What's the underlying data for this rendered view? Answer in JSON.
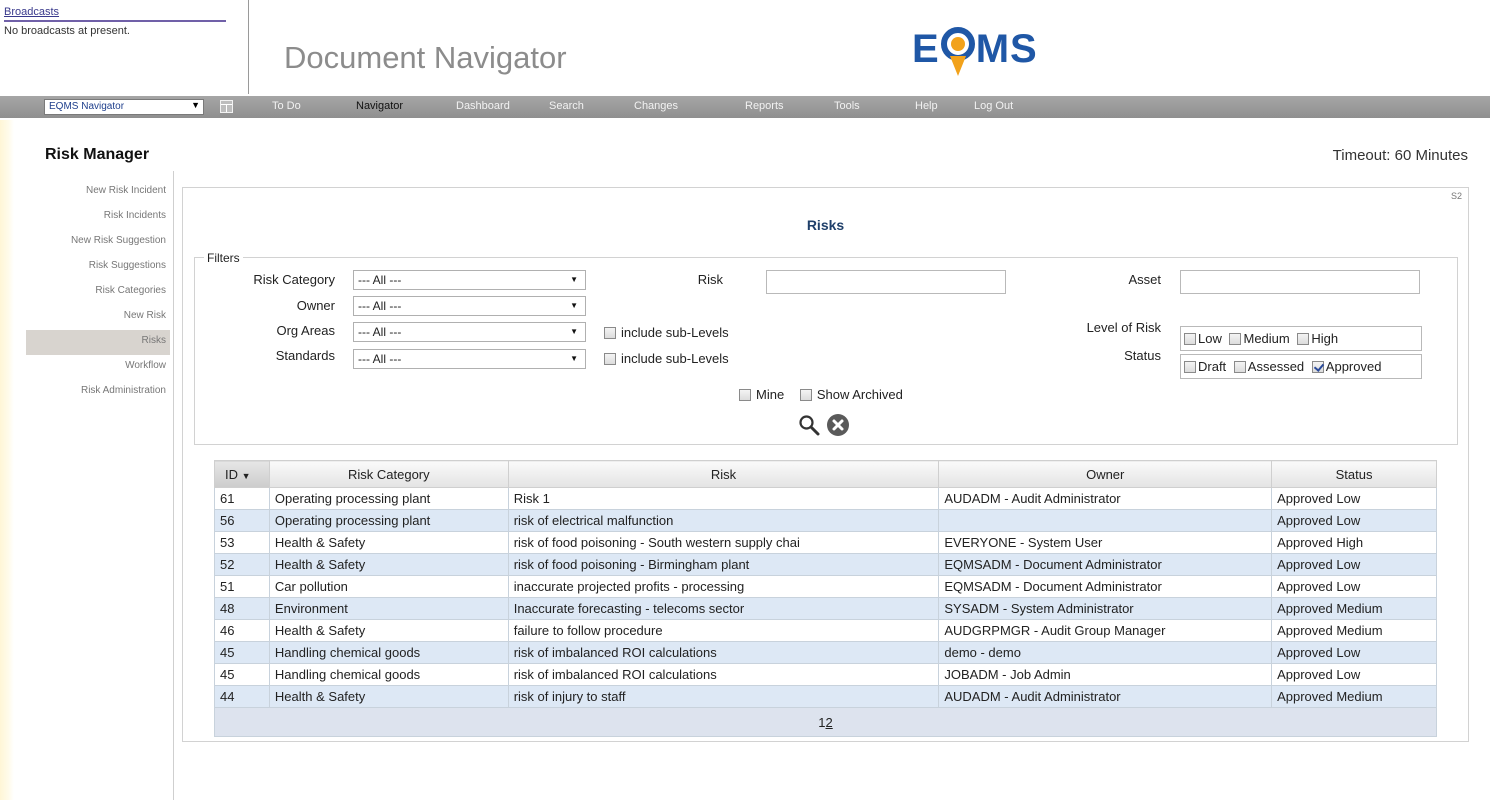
{
  "broadcasts": {
    "link": "Broadcasts",
    "message": "No broadcasts at present."
  },
  "app_title": "Document Navigator",
  "logo": {
    "left": "E",
    "right": "MS",
    "icon": "q-pin-logo-icon"
  },
  "navbar": {
    "selector_value": "EQMS Navigator",
    "items": [
      "To Do",
      "Navigator",
      "Dashboard",
      "Search",
      "Changes",
      "Reports",
      "Tools",
      "Help",
      "Log Out"
    ],
    "active": "Navigator"
  },
  "module_title": "Risk Manager",
  "timeout": "Timeout: 60 Minutes",
  "sidebar": {
    "items": [
      "New Risk Incident",
      "Risk Incidents",
      "New Risk Suggestion",
      "Risk Suggestions",
      "Risk Categories",
      "New Risk",
      "Risks",
      "Workflow",
      "Risk Administration"
    ],
    "active": "Risks"
  },
  "panel": {
    "code": "S2",
    "title": "Risks"
  },
  "filters": {
    "legend": "Filters",
    "risk_category": {
      "label": "Risk Category",
      "value": "--- All ---"
    },
    "owner": {
      "label": "Owner",
      "value": "--- All ---"
    },
    "org_areas": {
      "label": "Org Areas",
      "value": "--- All ---"
    },
    "standards": {
      "label": "Standards",
      "value": "--- All ---"
    },
    "include_sub_org": {
      "label": "include sub-Levels",
      "checked": false
    },
    "include_sub_std": {
      "label": "include sub-Levels",
      "checked": false
    },
    "risk": {
      "label": "Risk",
      "value": ""
    },
    "asset": {
      "label": "Asset",
      "value": ""
    },
    "level_of_risk": {
      "label": "Level of Risk",
      "low": "Low",
      "medium": "Medium",
      "high": "High"
    },
    "status": {
      "label": "Status",
      "draft": "Draft",
      "assessed": "Assessed",
      "approved": "Approved"
    },
    "mine": "Mine",
    "show_archived": "Show Archived"
  },
  "table": {
    "columns": [
      "ID",
      "Risk Category",
      "Risk",
      "Owner",
      "Status"
    ],
    "rows": [
      [
        "61",
        "Operating processing plant",
        "Risk 1",
        "AUDADM - Audit Administrator",
        "Approved Low"
      ],
      [
        "56",
        "Operating processing plant",
        "risk of electrical malfunction",
        "",
        "Approved Low"
      ],
      [
        "53",
        "Health & Safety",
        "risk of food poisoning - South western supply chai",
        "EVERYONE - System User",
        "Approved High"
      ],
      [
        "52",
        "Health & Safety",
        "risk of food poisoning - Birmingham plant",
        "EQMSADM - Document Administrator",
        "Approved Low"
      ],
      [
        "51",
        "Car pollution",
        "inaccurate projected profits - processing",
        "EQMSADM - Document Administrator",
        "Approved Low"
      ],
      [
        "48",
        "Environment",
        "Inaccurate forecasting - telecoms sector",
        "SYSADM - System Administrator",
        "Approved Medium"
      ],
      [
        "46",
        "Health & Safety",
        "failure to follow procedure",
        "AUDGRPMGR - Audit Group Manager",
        "Approved Medium"
      ],
      [
        "45",
        "Handling chemical goods",
        "risk of imbalanced ROI calculations",
        "demo - demo",
        "Approved Low"
      ],
      [
        "45",
        "Handling chemical goods",
        "risk of imbalanced ROI calculations",
        "JOBADM - Job Admin",
        "Approved Low"
      ],
      [
        "44",
        "Health & Safety",
        "risk of injury to staff",
        "AUDADM - Audit Administrator",
        "Approved Medium"
      ]
    ],
    "pages": [
      "1",
      "2"
    ],
    "current_page": "1"
  },
  "colors": {
    "brand_blue": "#1f57a6",
    "brand_orange": "#f2a21b",
    "row_alt": "#dde8f5",
    "navbar": "#9a9a9a"
  }
}
